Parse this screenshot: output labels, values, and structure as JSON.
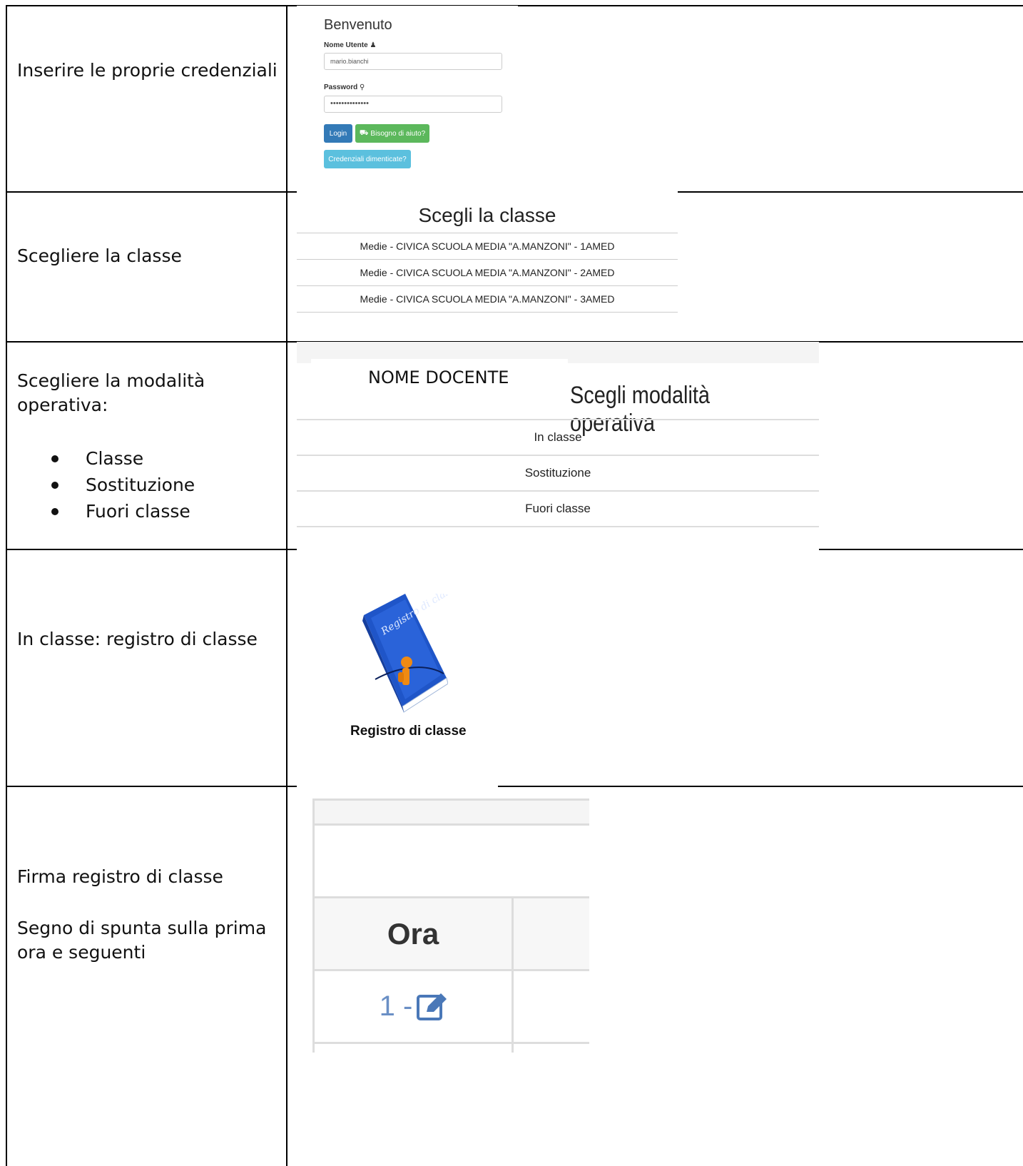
{
  "rows": {
    "credenziali": "Inserire le proprie credenziali",
    "classe": "Scegliere la classe",
    "modalita": "Scegliere la modalità operativa:",
    "modalita_items": [
      "Classe",
      "Sostituzione",
      "Fuori classe"
    ],
    "registro": "In classe: registro di classe",
    "firma_title": "Firma registro di classe",
    "firma_desc": "Segno di spunta sulla prima ora e seguenti"
  },
  "login": {
    "title": "Benvenuto",
    "username_label": "Nome Utente",
    "username_value": "mario.bianchi",
    "password_label": "Password",
    "password_value": "••••••••••••••",
    "login_button": "Login",
    "help_button": "Bisogno di aiuto?",
    "forgot_button": "Credenziali dimenticate?",
    "colors": {
      "primary": "#337ab7",
      "success": "#5cb85c",
      "info": "#5bc0de"
    }
  },
  "class_select": {
    "title": "Scegli la classe",
    "items": [
      "Medie - CIVICA SCUOLA MEDIA \"A.MANZONI\" - 1AMED",
      "Medie - CIVICA SCUOLA MEDIA \"A.MANZONI\" - 2AMED",
      "Medie - CIVICA SCUOLA MEDIA \"A.MANZONI\" - 3AMED"
    ]
  },
  "mode_select": {
    "teacher": "NOME DOCENTE",
    "title": "Scegli modalità operativa",
    "items": [
      "In classe",
      "Sostituzione",
      "Fuori classe"
    ]
  },
  "registro": {
    "caption": "Registro di classe",
    "book_text": "Registro di classe"
  },
  "firma": {
    "header": "Ora",
    "first_row": "1 -",
    "edit_icon": "edit-icon"
  }
}
